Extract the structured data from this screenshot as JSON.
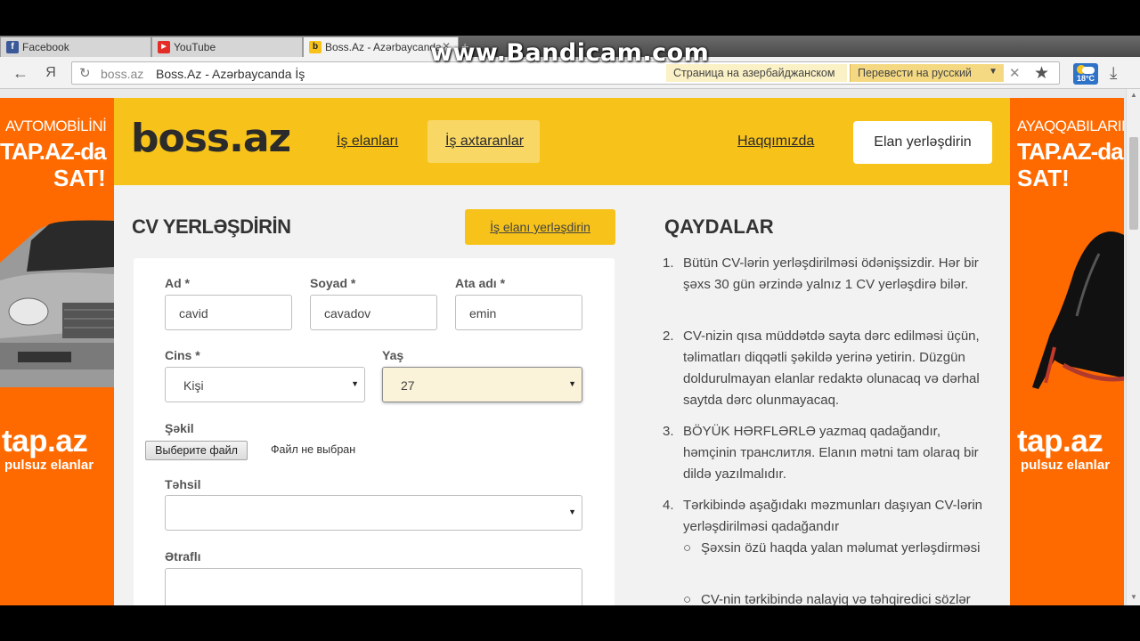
{
  "browser": {
    "tabs": [
      {
        "label": "Facebook",
        "icon": "facebook-icon"
      },
      {
        "label": "YouTube",
        "icon": "youtube-icon"
      },
      {
        "label": "Boss.Az - Azərbaycanda",
        "icon": "bossaz-icon"
      }
    ],
    "watermark": "www.Bandicam.com",
    "back_label": "←",
    "yandex_label": "Я",
    "url_host": "boss.az",
    "url_title": "Boss.Az - Azərbaycanda İş",
    "translate_info": "Страница на азербайджанском",
    "translate_button": "Перевести на русский",
    "weather": "18°C"
  },
  "ads": {
    "left": {
      "line1": "AVTOMOBİLİNİ",
      "line2": "TAP.AZ-da",
      "line3": "SAT!",
      "brand": "tap.az",
      "tag": "pulsuz elanlar"
    },
    "right": {
      "line1": "AYAQQABILARINI",
      "line2": "TAP.AZ-da",
      "line3": "SAT!",
      "brand": "tap.az",
      "tag": "pulsuz elanlar"
    }
  },
  "header": {
    "logo": "boss.az",
    "nav": [
      "İş elanları",
      "İş axtaranlar",
      "Haqqımızda"
    ],
    "post_button": "Elan yerləşdirin"
  },
  "form": {
    "title": "CV YERLƏŞDİRİN",
    "job_post_button": "İş elanı yerləşdirin",
    "fields": {
      "ad": {
        "label": "Ad *",
        "value": "cavid"
      },
      "soyad": {
        "label": "Soyad *",
        "value": "cavadov"
      },
      "ata_adi": {
        "label": "Ata adı *",
        "value": "emin"
      },
      "cins": {
        "label": "Cins *",
        "value": "Kişi"
      },
      "yas": {
        "label": "Yaş",
        "value": "27"
      },
      "sekil": {
        "label": "Şəkil",
        "button": "Выберите файл",
        "status": "Файл не выбран"
      },
      "tehsil": {
        "label": "Təhsil",
        "value": ""
      },
      "etrafli": {
        "label": "Ətraflı",
        "value": ""
      }
    }
  },
  "rules": {
    "title": "QAYDALAR",
    "items": [
      {
        "num": "1.",
        "text": "Bütün CV-lərin yerləşdirilməsi ödənişsizdir. Hər bir şəxs 30 gün ərzində yalnız 1 CV yerləşdirə bilər."
      },
      {
        "num": "2.",
        "text": "CV-nizin qısa müddətdə sayta dərc edilməsi üçün, təlimatları diqqətli şəkildə yerinə yetirin. Düzgün doldurulmayan elanlar redaktə olunacaq və dərhal saytda dərc olunmayacaq."
      },
      {
        "num": "3.",
        "text": "BÖYÜK HƏRFLƏRLƏ yazmaq qadağandır, həmçinin транслитля. Elanın mətni tam olaraq bir dildə yazılmalıdır."
      },
      {
        "num": "4.",
        "text": "Tərkibində aşağıdakı məzmunları daşıyan CV-lərin yerləşdirilməsi qadağandır"
      }
    ],
    "subitems": [
      {
        "bullet": "○",
        "text": "Şəxsin özü haqda yalan məlumat yerləşdirməsi"
      },
      {
        "bullet": "○",
        "text": "CV-nin tərkibində nalayiq və təhqiredici sözlər"
      }
    ]
  },
  "colors": {
    "brand": "#f7c31a",
    "ad_orange": "#ff6a00"
  }
}
